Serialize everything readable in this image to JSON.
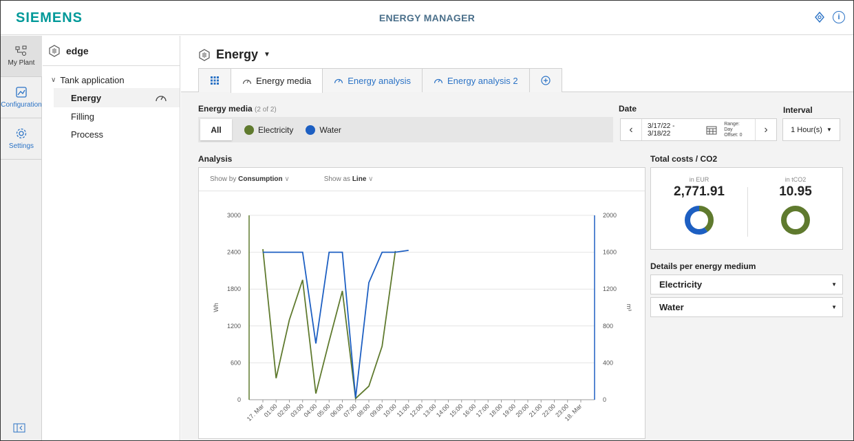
{
  "header": {
    "logo": "SIEMENS",
    "title": "ENERGY MANAGER",
    "info_icon": "i"
  },
  "leftnav": {
    "items": [
      {
        "label": "My Plant",
        "icon": "plant-icon"
      },
      {
        "label": "Configuration",
        "icon": "configuration-icon"
      },
      {
        "label": "Settings",
        "icon": "gear-icon"
      }
    ]
  },
  "tree": {
    "root": "edge",
    "parent": "Tank application",
    "children": [
      "Energy",
      "Filling",
      "Process"
    ]
  },
  "page": {
    "title": "Energy",
    "tabs": [
      {
        "label": "",
        "icon": "grid-icon"
      },
      {
        "label": "Energy media",
        "icon": "gauge-icon"
      },
      {
        "label": "Energy analysis",
        "icon": "gauge-icon"
      },
      {
        "label": "Energy analysis 2",
        "icon": "gauge-icon"
      },
      {
        "label": "",
        "icon": "add-icon"
      }
    ]
  },
  "filters": {
    "media_label": "Energy media",
    "media_count": "(2 of 2)",
    "all": "All",
    "electricity": "Electricity",
    "water": "Water",
    "date_label": "Date",
    "date_range": "3/17/22 - 3/18/22",
    "range_text": "Range: Day",
    "offset_text": "Offset: 0",
    "interval_label": "Interval",
    "interval_value": "1 Hour(s)"
  },
  "analysis": {
    "label": "Analysis",
    "show_by_prefix": "Show by",
    "show_by_value": "Consumption",
    "show_as_prefix": "Show as",
    "show_as_value": "Line"
  },
  "totals": {
    "label": "Total costs / CO2",
    "eur_label": "in EUR",
    "eur_value": "2,771.91",
    "co2_label": "in tCO2",
    "co2_value": "10.95",
    "eur_share": {
      "electricity": 0.4,
      "water": 0.6
    },
    "co2_share": {
      "electricity": 1.0,
      "water": 0.0
    }
  },
  "details": {
    "label": "Details per energy medium",
    "options": [
      "Electricity",
      "Water"
    ]
  },
  "colors": {
    "electricity": "#5f7a2e",
    "water": "#1d5fc2",
    "accent": "#009999",
    "link": "#2a72c5"
  },
  "chart_data": {
    "type": "line",
    "x": [
      "17. Mar",
      "01:00",
      "02:00",
      "03:00",
      "04:00",
      "05:00",
      "06:00",
      "07:00",
      "08:00",
      "09:00",
      "10:00",
      "11:00",
      "12:00",
      "13:00",
      "14:00",
      "15:00",
      "16:00",
      "17:00",
      "18:00",
      "19:00",
      "20:00",
      "21:00",
      "22:00",
      "23:00",
      "18. Mar"
    ],
    "ylabel": "Wh",
    "y2label": "m³",
    "ylim": [
      0,
      3000
    ],
    "y2lim": [
      0,
      2000
    ],
    "yticks": [
      0,
      600,
      1200,
      1800,
      2400,
      3000
    ],
    "y2ticks": [
      0,
      400,
      800,
      1200,
      1600,
      2000
    ],
    "grid": true,
    "series": [
      {
        "name": "Electricity",
        "axis": "left",
        "values": [
          2450,
          350,
          1300,
          1950,
          100,
          950,
          1770,
          20,
          220,
          870,
          2420
        ]
      },
      {
        "name": "Water",
        "axis": "right",
        "values": [
          1600,
          1600,
          1600,
          1600,
          610,
          1600,
          1600,
          20,
          1270,
          1600,
          1600,
          1620
        ]
      }
    ]
  }
}
